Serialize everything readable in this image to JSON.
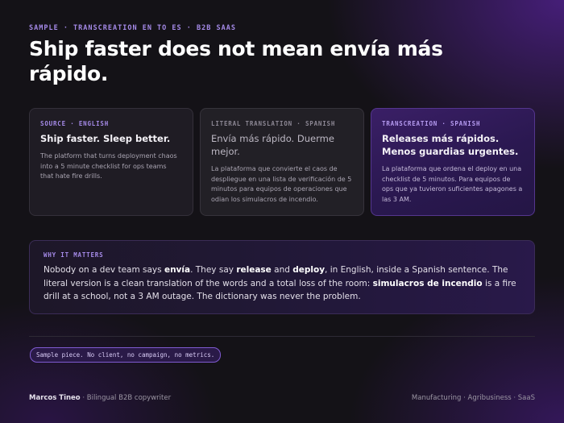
{
  "header": {
    "eyebrow": "SAMPLE · TRANSCREATION EN TO ES · B2B SAAS",
    "headline": "Ship faster does not mean envía más rápido."
  },
  "cards": [
    {
      "label": "SOURCE · ENGLISH",
      "title": "Ship faster. Sleep better.",
      "body": "The platform that turns deployment chaos into a 5 minute checklist for ops teams that hate fire drills."
    },
    {
      "label": "LITERAL TRANSLATION · SPANISH",
      "title": "Envía más rápido. Duerme mejor.",
      "body": "La plataforma que convierte el caos de despliegue en una lista de verificación de 5 minutos para equipos de operaciones que odian los simulacros de incendio."
    },
    {
      "label": "TRANSCREATION · SPANISH",
      "title": "Releases más rápidos. Menos guardias urgentes.",
      "body": "La plataforma que ordena el deploy en una checklist de 5 minutos. Para equipos de ops que ya tuvieron suficientes apagones a las 3 AM."
    }
  ],
  "why": {
    "label": "WHY IT MATTERS",
    "t1": "Nobody on a dev team says ",
    "b1": "envía",
    "t2": ". They say ",
    "b2": "release",
    "t3": " and ",
    "b3": "deploy",
    "t4": ", in English, inside a Spanish sentence. The literal version is a clean translation of the words and a total loss of the room: ",
    "b4": "simulacros de incendio",
    "t5": " is a fire drill at a school, not a 3 AM outage. The dictionary was never the problem."
  },
  "badge": "Sample piece. No client, no campaign, no metrics.",
  "footer": {
    "name": "Marcos Tineo",
    "separator": " · ",
    "role": "Bilingual B2B copywriter",
    "tags": "Manufacturing · Agribusiness · SaaS"
  },
  "colors": {
    "accent": "#a58ae8",
    "background": "#141217",
    "highlight_card": "#2a1850"
  }
}
